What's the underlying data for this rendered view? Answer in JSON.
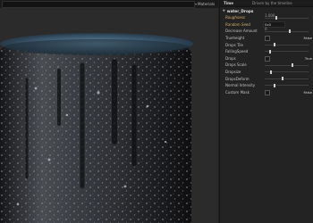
{
  "viewport": {
    "dropdown_label": "Materials"
  },
  "panel": {
    "header": {
      "time": "Time",
      "driven": "Driven by the timeline"
    },
    "section": "water_Drops",
    "rows": [
      {
        "label": "Roughness",
        "kind": "slider",
        "value": "1.000",
        "fraction": 0.25,
        "accent": true
      },
      {
        "label": "Random Seed",
        "kind": "field",
        "value": "0x0",
        "accent": true
      },
      {
        "label": "Decrease Amount",
        "kind": "slider",
        "value": "0",
        "fraction": 0.55
      },
      {
        "label": "Trueheight",
        "kind": "bool",
        "value": "False"
      },
      {
        "label": "Drops Tile",
        "kind": "slider",
        "value": "",
        "fraction": 0.2
      },
      {
        "label": "FallingSpeed",
        "kind": "slider",
        "value": "",
        "fraction": 0.1
      },
      {
        "label": "Drops",
        "kind": "bool",
        "value": "True"
      },
      {
        "label": "Drops Scale",
        "kind": "slider",
        "value": "",
        "fraction": 0.62
      },
      {
        "label": "Dropsize",
        "kind": "slider",
        "value": "",
        "fraction": 0.12
      },
      {
        "label": "DropsDeform",
        "kind": "slider",
        "value": "",
        "fraction": 0.38
      },
      {
        "label": "Normal Intensity",
        "kind": "slider",
        "value": "",
        "fraction": 0.2
      },
      {
        "label": "Custom Mask",
        "kind": "bool",
        "value": "False"
      }
    ]
  }
}
